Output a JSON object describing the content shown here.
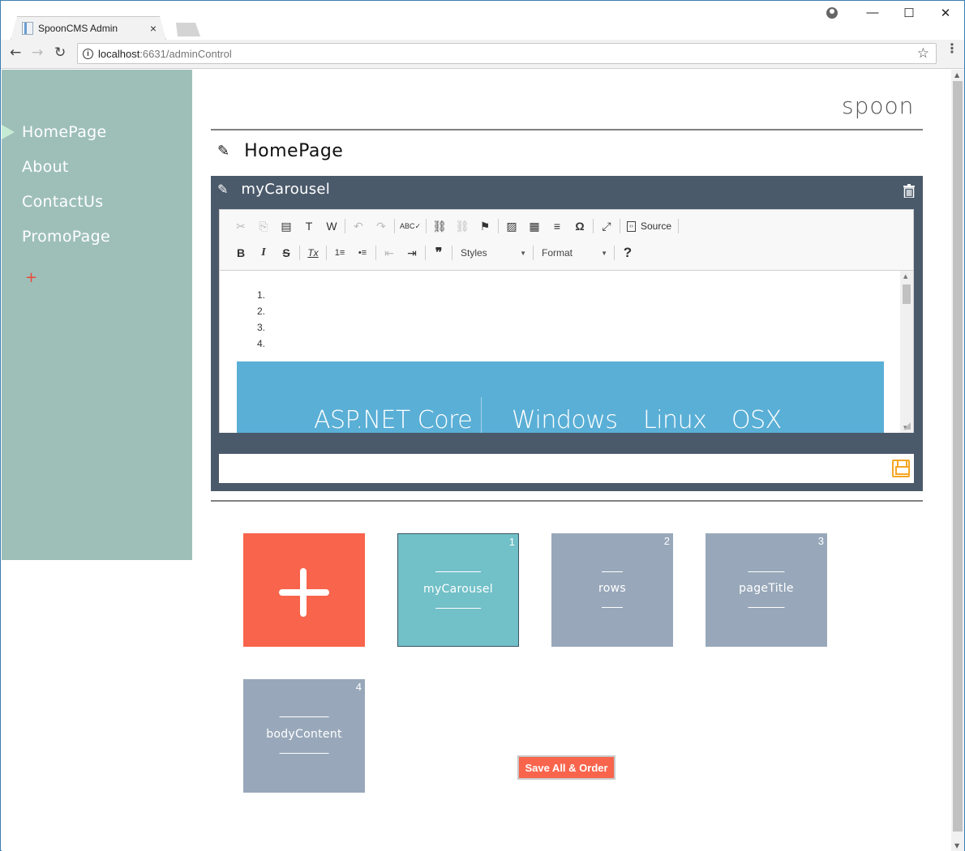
{
  "browser": {
    "tab_title": "SpoonCMS Admin",
    "tab_close": "×",
    "url_host": "localhost",
    "url_rest": ":6631/adminControl",
    "controls": {
      "minimize": "—",
      "maximize": "☐",
      "close": "✕"
    },
    "nav": {
      "back": "←",
      "forward": "→",
      "reload": "↻"
    },
    "info_glyph": "i",
    "star_glyph": "☆",
    "menu_glyph": "⋮"
  },
  "sidebar": {
    "items": [
      {
        "label": "HomePage",
        "active": true
      },
      {
        "label": "About",
        "active": false
      },
      {
        "label": "ContactUs",
        "active": false
      },
      {
        "label": "PromoPage",
        "active": false
      }
    ],
    "add_label": "+"
  },
  "header": {
    "brand": "spoon",
    "page_title": "HomePage",
    "pencil_glyph": "✎"
  },
  "panel": {
    "title": "myCarousel",
    "accent": "#4b5a6b"
  },
  "editor": {
    "toolbar_row1": {
      "cut": "✂",
      "copy": "⎘",
      "paste": "📋",
      "paste_text": "T",
      "paste_word": "W",
      "undo": "↶",
      "redo": "↷",
      "spellcheck": "ABC✓",
      "link": "⛓",
      "unlink": "⛓",
      "anchor": "⚑",
      "image": "▨",
      "table": "▦",
      "hr": "≡",
      "special_char": "Ω",
      "maximize": "⤢",
      "source_label": "Source"
    },
    "toolbar_row2": {
      "bold": "B",
      "italic": "I",
      "strike": "S",
      "remove_format": "Tx",
      "numbered_list": "1≡",
      "bulleted_list": "•≡",
      "outdent": "⇤",
      "indent": "⇥",
      "blockquote": "❞",
      "styles_label": "Styles",
      "format_label": "Format",
      "help": "?"
    },
    "content": {
      "list_items": [
        "1.",
        "2.",
        "3.",
        "4."
      ],
      "banner": {
        "product": "ASP.NET Core",
        "platforms": [
          "Windows",
          "Linux",
          "OSX"
        ],
        "color": "#5aafd6"
      }
    }
  },
  "tiles": [
    {
      "kind": "add",
      "label": "+"
    },
    {
      "kind": "item",
      "number": "1",
      "label": "myCarousel",
      "active": true
    },
    {
      "kind": "item",
      "number": "2",
      "label": "rows",
      "active": false
    },
    {
      "kind": "item",
      "number": "3",
      "label": "pageTitle",
      "active": false
    },
    {
      "kind": "item",
      "number": "4",
      "label": "bodyContent",
      "active": false
    }
  ],
  "actions": {
    "save_all_label": "Save All & Order"
  },
  "colors": {
    "sidebar": "#9dbfb8",
    "add_tile": "#f8644c",
    "active_tile": "#72c0c8",
    "tile": "#98a8ba",
    "save_icon": "#f5a623"
  }
}
